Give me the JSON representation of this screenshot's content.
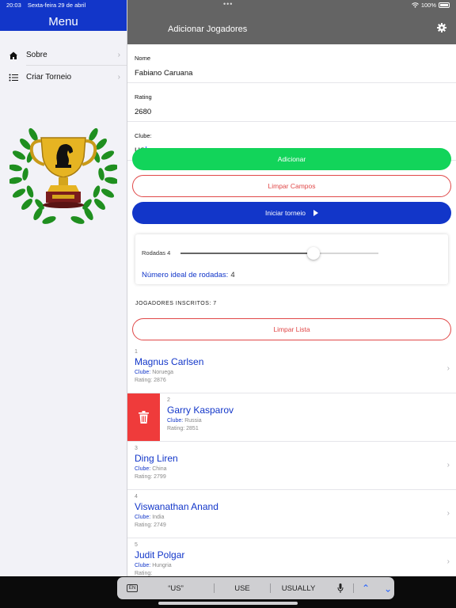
{
  "status": {
    "time": "20:03",
    "date": "Sexta-feira 29 de abril",
    "battery": "100%"
  },
  "sidebar": {
    "title": "Menu",
    "items": [
      {
        "label": "Sobre",
        "icon": "house-icon"
      },
      {
        "label": "Criar Torneio",
        "icon": "list-icon"
      }
    ]
  },
  "header": {
    "title": "Adicionar Jogadores",
    "icon": "gear-icon"
  },
  "form": {
    "name_label": "Nome",
    "name_value": "Fabiano Caruana",
    "rating_label": "Rating",
    "rating_value": "2680",
    "club_label": "Clube:",
    "club_value": "US"
  },
  "buttons": {
    "add": "Adicionar",
    "clear_fields": "Limpar Campos",
    "start": "Iniciar torneio",
    "clear_list": "Limpar Lista"
  },
  "rounds": {
    "label": "Rodadas 4",
    "slider_fraction": 0.67,
    "ideal_label": "Número ideal de rodadas:",
    "ideal_value": "4"
  },
  "players_header": "JOGADORES INSCRITOS: 7",
  "players": [
    {
      "num": "1",
      "name": "Magnus Carlsen",
      "club_label": "Clube:",
      "club": "Noruega",
      "rating_label": "Rating:",
      "rating": "2876"
    },
    {
      "num": "2",
      "name": "Garry Kasparov",
      "club_label": "Clube:",
      "club": "Russia",
      "rating_label": "Rating:",
      "rating": "2851"
    },
    {
      "num": "3",
      "name": "Ding Liren",
      "club_label": "Clube:",
      "club": "China",
      "rating_label": "Rating:",
      "rating": "2799"
    },
    {
      "num": "4",
      "name": "Viswanathan Anand",
      "club_label": "Clube:",
      "club": "India",
      "rating_label": "Rating:",
      "rating": "2749"
    },
    {
      "num": "5",
      "name": "Judit Polgar",
      "club_label": "Clube:",
      "club": "Hungria",
      "rating_label": "Rating:",
      "rating": ""
    }
  ],
  "keyboard": {
    "lang": "EN",
    "suggestions": [
      "“US”",
      "USE",
      "USUALLY"
    ]
  },
  "colors": {
    "primary": "#1236c9",
    "add": "#12d45a",
    "danger": "#e04848",
    "delete": "#ef3b3b",
    "nav": "#646464"
  }
}
